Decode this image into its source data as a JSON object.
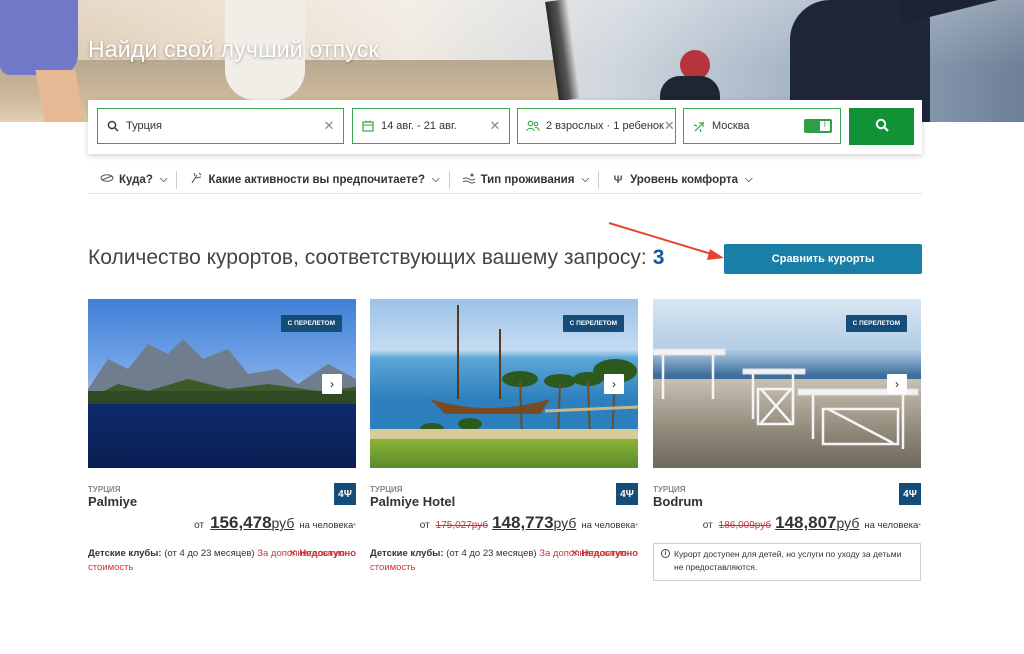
{
  "hero": {
    "title": "Найди свой лучший отпуск"
  },
  "search": {
    "destination": "Турция",
    "dates": "14 авг. - 21 авг.",
    "guests": "2 взрослых · 1 ребенок",
    "origin": "Москва",
    "origin_toggle_on": true,
    "icons": {
      "destination": "search-icon",
      "dates": "calendar-icon",
      "guests": "people-icon",
      "origin": "airplane-icon",
      "submit": "search-icon"
    },
    "accent_color": "#129236"
  },
  "filters": [
    {
      "label": "Куда?",
      "icon": "globe-icon"
    },
    {
      "label": "Какие активности вы предпочитаете?",
      "icon": "activity-icon"
    },
    {
      "label": "Тип проживания",
      "icon": "accommodation-icon"
    },
    {
      "label": "Уровень комфорта",
      "icon": "comfort-icon"
    }
  ],
  "results": {
    "title": "Количество курортов, соответствующих вашему запросу:",
    "count": "3",
    "compare_button": "Сравнить курорты"
  },
  "cards": [
    {
      "badge": "С ПЕРЕЛЕТОМ",
      "country": "ТУРЦИЯ",
      "name": "Palmiye",
      "rating": "4Ψ",
      "price_from": "от",
      "price_old": "",
      "price_new": "156,478",
      "currency": "руб",
      "per": "на человека",
      "footnote": "*",
      "kids_label": "Детские клубы:",
      "kids_text": "(от 4 до 23 месяцев)",
      "kids_extra": "За дополнительную стоимость",
      "kids_status": "Недоступно"
    },
    {
      "badge": "С ПЕРЕЛЕТОМ",
      "country": "ТУРЦИЯ",
      "name": "Palmiye Hotel",
      "rating": "4Ψ",
      "price_from": "от",
      "price_old": "175,027руб",
      "price_new": "148,773",
      "currency": "руб",
      "per": "на человека",
      "footnote": "*",
      "kids_label": "Детские клубы:",
      "kids_text": "(от 4 до 23 месяцев)",
      "kids_extra": "За дополнительную стоимость",
      "kids_status": "Недоступно"
    },
    {
      "badge": "С ПЕРЕЛЕТОМ",
      "country": "ТУРЦИЯ",
      "name": "Bodrum",
      "rating": "4Ψ",
      "price_from": "от",
      "price_old": "186,009руб",
      "price_new": "148,807",
      "currency": "руб",
      "per": "на человека",
      "footnote": "*",
      "notice": "Курорт доступен для детей, но услуги по уходу за детьми не предоставляются."
    }
  ],
  "colors": {
    "brand_green": "#129236",
    "compare_blue": "#1a7fa6",
    "badge_navy": "#164c78",
    "price_red": "#c8363c"
  }
}
